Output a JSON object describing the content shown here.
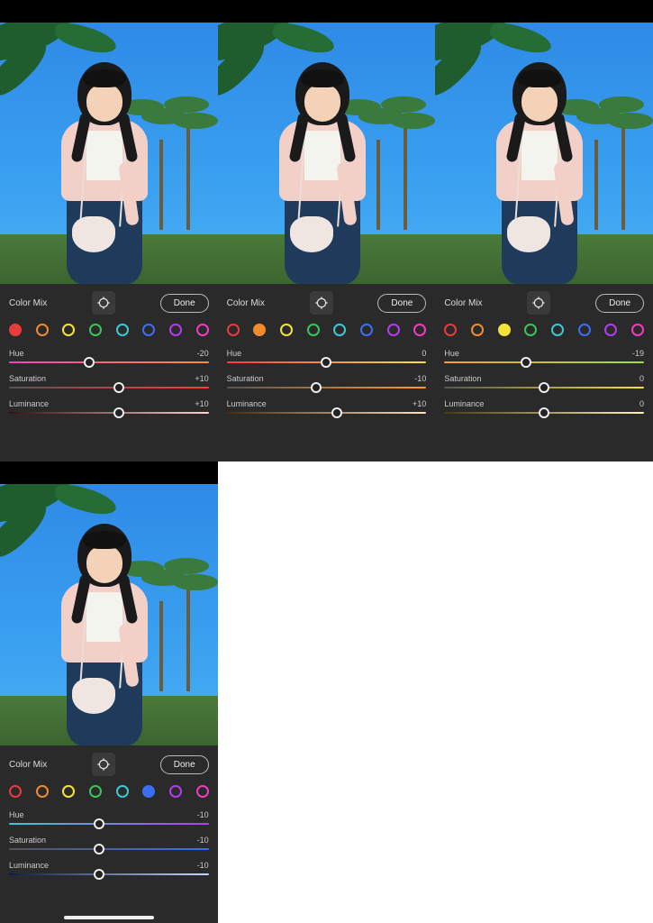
{
  "swatch_colors": [
    "#e63c3c",
    "#f08c2e",
    "#f5e23c",
    "#3cc45a",
    "#3cc8d6",
    "#3c6ef0",
    "#b23cf0",
    "#f03cc0"
  ],
  "panels": [
    {
      "title": "Color Mix",
      "done": "Done",
      "selected_swatch": 0,
      "sliders": [
        {
          "name": "Hue",
          "value": "-20",
          "pos": 40,
          "grad": [
            "#ff3cc0",
            "#ff8c2e"
          ]
        },
        {
          "name": "Saturation",
          "value": "+10",
          "pos": 55,
          "grad": [
            "#555555",
            "#ff3c3c"
          ]
        },
        {
          "name": "Luminance",
          "value": "+10",
          "pos": 55,
          "grad": [
            "#3a0f0f",
            "#ffd2d2"
          ]
        }
      ],
      "homebar": false
    },
    {
      "title": "Color Mix",
      "done": "Done",
      "selected_swatch": 1,
      "sliders": [
        {
          "name": "Hue",
          "value": "0",
          "pos": 50,
          "grad": [
            "#ff3c3c",
            "#f5e23c"
          ]
        },
        {
          "name": "Saturation",
          "value": "-10",
          "pos": 45,
          "grad": [
            "#555555",
            "#ff9a2e"
          ]
        },
        {
          "name": "Luminance",
          "value": "+10",
          "pos": 55,
          "grad": [
            "#4a2a0a",
            "#ffe3b8"
          ]
        }
      ],
      "homebar": false
    },
    {
      "title": "Color Mix",
      "done": "Done",
      "selected_swatch": 2,
      "sliders": [
        {
          "name": "Hue",
          "value": "-19",
          "pos": 41,
          "grad": [
            "#ff9a2e",
            "#9ae23c"
          ]
        },
        {
          "name": "Saturation",
          "value": "0",
          "pos": 50,
          "grad": [
            "#555555",
            "#f5e23c"
          ]
        },
        {
          "name": "Luminance",
          "value": "0",
          "pos": 50,
          "grad": [
            "#4a3a0a",
            "#fff5b8"
          ]
        }
      ],
      "homebar": false
    },
    {
      "title": "Color Mix",
      "done": "Done",
      "selected_swatch": 5,
      "sliders": [
        {
          "name": "Hue",
          "value": "-10",
          "pos": 45,
          "grad": [
            "#3cc8d6",
            "#b23cf0"
          ]
        },
        {
          "name": "Saturation",
          "value": "-10",
          "pos": 45,
          "grad": [
            "#555555",
            "#3c6ef0"
          ]
        },
        {
          "name": "Luminance",
          "value": "-10",
          "pos": 45,
          "grad": [
            "#0f1a4a",
            "#c8d6ff"
          ]
        }
      ],
      "homebar": true
    }
  ]
}
